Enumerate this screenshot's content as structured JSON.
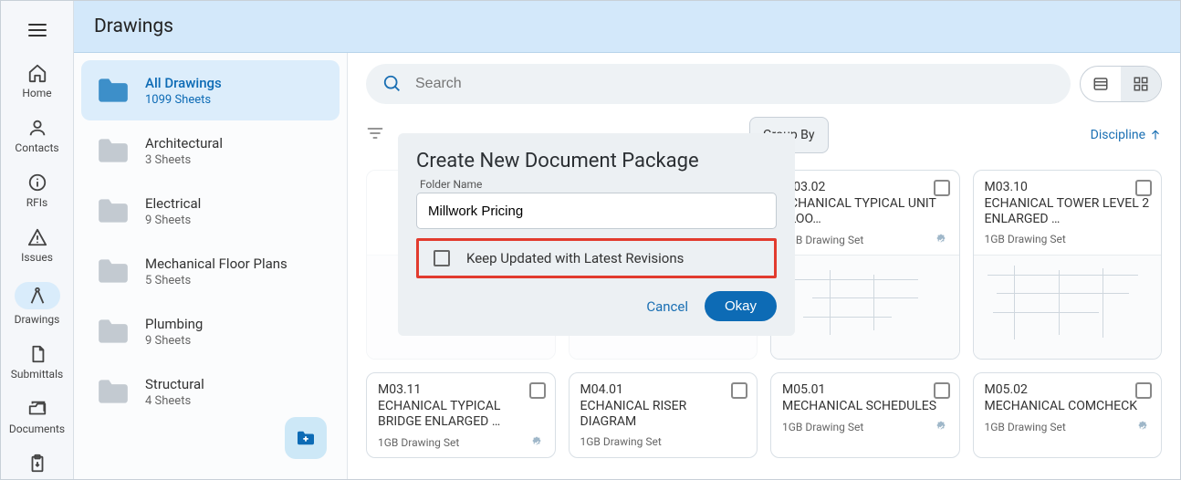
{
  "header": {
    "title": "Drawings"
  },
  "rail": {
    "items": [
      {
        "label": "Home"
      },
      {
        "label": "Contacts"
      },
      {
        "label": "RFIs"
      },
      {
        "label": "Issues"
      },
      {
        "label": "Drawings"
      },
      {
        "label": "Submittals"
      },
      {
        "label": "Documents"
      }
    ]
  },
  "folders": {
    "items": [
      {
        "title": "All Drawings",
        "sub": "1099 Sheets"
      },
      {
        "title": "Architectural",
        "sub": "3 Sheets"
      },
      {
        "title": "Electrical",
        "sub": "9 Sheets"
      },
      {
        "title": "Mechanical Floor Plans",
        "sub": "5 Sheets"
      },
      {
        "title": "Plumbing",
        "sub": "9 Sheets"
      },
      {
        "title": "Structural",
        "sub": "4 Sheets"
      }
    ]
  },
  "toolbar": {
    "search_placeholder": "Search"
  },
  "filters": {
    "groupby_label": "Group By",
    "sort_label": "Discipline"
  },
  "cards": [
    {
      "num": "M03.02",
      "title": "ECHANICAL TYPICAL UNIT FLOO…",
      "set": "1GB Drawing Set"
    },
    {
      "num": "M03.10",
      "title": "ECHANICAL TOWER LEVEL 2 ENLARGED …",
      "set": "1GB Drawing Set"
    },
    {
      "num": "M03.11",
      "title": "ECHANICAL TYPICAL BRIDGE ENLARGED …",
      "set": "1GB Drawing Set"
    },
    {
      "num": "M04.01",
      "title": "ECHANICAL RISER DIAGRAM",
      "set": "1GB Drawing Set"
    },
    {
      "num": "M05.01",
      "title": "MECHANICAL SCHEDULES",
      "set": "1GB Drawing Set"
    },
    {
      "num": "M05.02",
      "title": "MECHANICAL COMCHECK",
      "set": "1GB Drawing Set"
    }
  ],
  "modal": {
    "title": "Create New Document Package",
    "field_label": "Folder Name",
    "field_value": "Millwork Pricing",
    "checkbox_label": "Keep Updated with Latest Revisions",
    "cancel_label": "Cancel",
    "ok_label": "Okay"
  }
}
